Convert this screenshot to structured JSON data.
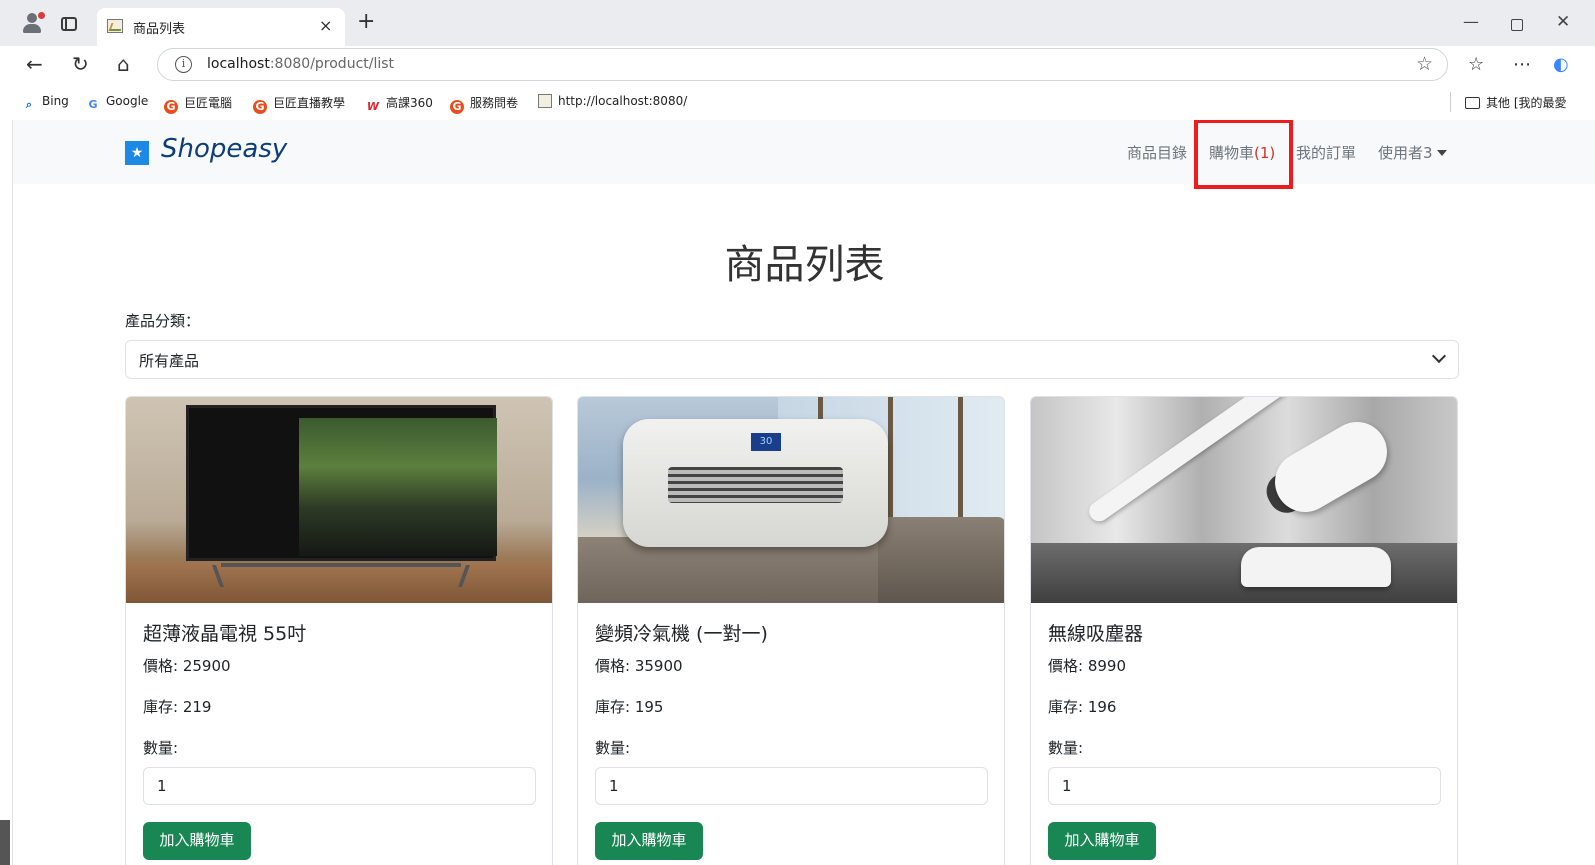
{
  "browser": {
    "tab_title": "商品列表",
    "tab_close": "×",
    "new_tab": "+",
    "url_host": "localhost",
    "url_path": ":8080/product/list",
    "info_icon": "i",
    "win_min": "—",
    "win_close": "✕",
    "bookmarks": [
      {
        "icon": "search-icon",
        "glyph": "Q",
        "label": "Bing"
      },
      {
        "icon": "google-icon",
        "glyph": "G",
        "label": "Google"
      },
      {
        "icon": "g-logo-icon",
        "glyph": "G",
        "label": "巨匠電腦"
      },
      {
        "icon": "g-logo-icon",
        "glyph": "G",
        "label": "巨匠直播教學"
      },
      {
        "icon": "w-logo-icon",
        "glyph": "W",
        "label": "高課360"
      },
      {
        "icon": "g-logo-icon",
        "glyph": "G",
        "label": "服務問卷"
      },
      {
        "icon": "page-icon",
        "glyph": "",
        "label": "http://localhost:8080/"
      }
    ],
    "other_bookmarks": "其他 [我的最愛"
  },
  "navbar": {
    "brand": "Shopeasy",
    "brand_icon": "★",
    "links": {
      "catalog": "商品目錄",
      "cart_label": "購物車",
      "cart_count": "(1)",
      "orders": "我的訂單",
      "user": "使用者3"
    }
  },
  "main": {
    "heading": "商品列表",
    "category_label": "產品分類：",
    "category_selected": "所有產品"
  },
  "products": [
    {
      "name": "超薄液晶電視 55吋",
      "price": "價格: 25900",
      "stock": "庫存: 219",
      "qty_label": "數量:",
      "qty": "1",
      "button": "加入購物車",
      "image": "tv-image"
    },
    {
      "name": "變頻冷氣機 (一對一)",
      "price": "價格: 35900",
      "stock": "庫存: 195",
      "qty_label": "數量:",
      "qty": "1",
      "button": "加入購物車",
      "image": "air-conditioner-image"
    },
    {
      "name": "無線吸塵器",
      "price": "價格: 8990",
      "stock": "庫存: 196",
      "qty_label": "數量:",
      "qty": "1",
      "button": "加入購物車",
      "image": "vacuum-image"
    }
  ],
  "colors": {
    "highlight": "#ee1c1c",
    "button_green": "#198754",
    "brand_blue": "#0d3d78",
    "cart_count": "#d0342c"
  }
}
